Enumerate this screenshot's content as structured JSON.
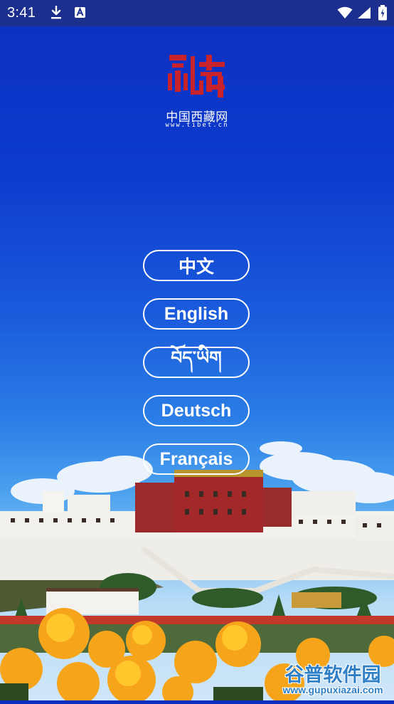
{
  "status_bar": {
    "time": "3:41",
    "icons": [
      "download-icon",
      "a-icon",
      "wifi-icon",
      "signal-icon",
      "battery-icon"
    ]
  },
  "logo": {
    "icon": "tibet-logo-icon",
    "title": "中国西藏网",
    "url": "www.tibet.cn",
    "color": "#c8232c"
  },
  "languages": [
    {
      "label": "中文"
    },
    {
      "label": "English"
    },
    {
      "label": "བོད་ཡིག"
    },
    {
      "label": "Deutsch"
    },
    {
      "label": "Français"
    }
  ],
  "watermark": {
    "title": "谷普软件园",
    "url": "www.gupuxiazai.com"
  },
  "colors": {
    "status_bar": "#1c2f8f",
    "sky_top": "#0a2fc0",
    "button_border": "#ffffff",
    "button_text": "#ffffff"
  }
}
